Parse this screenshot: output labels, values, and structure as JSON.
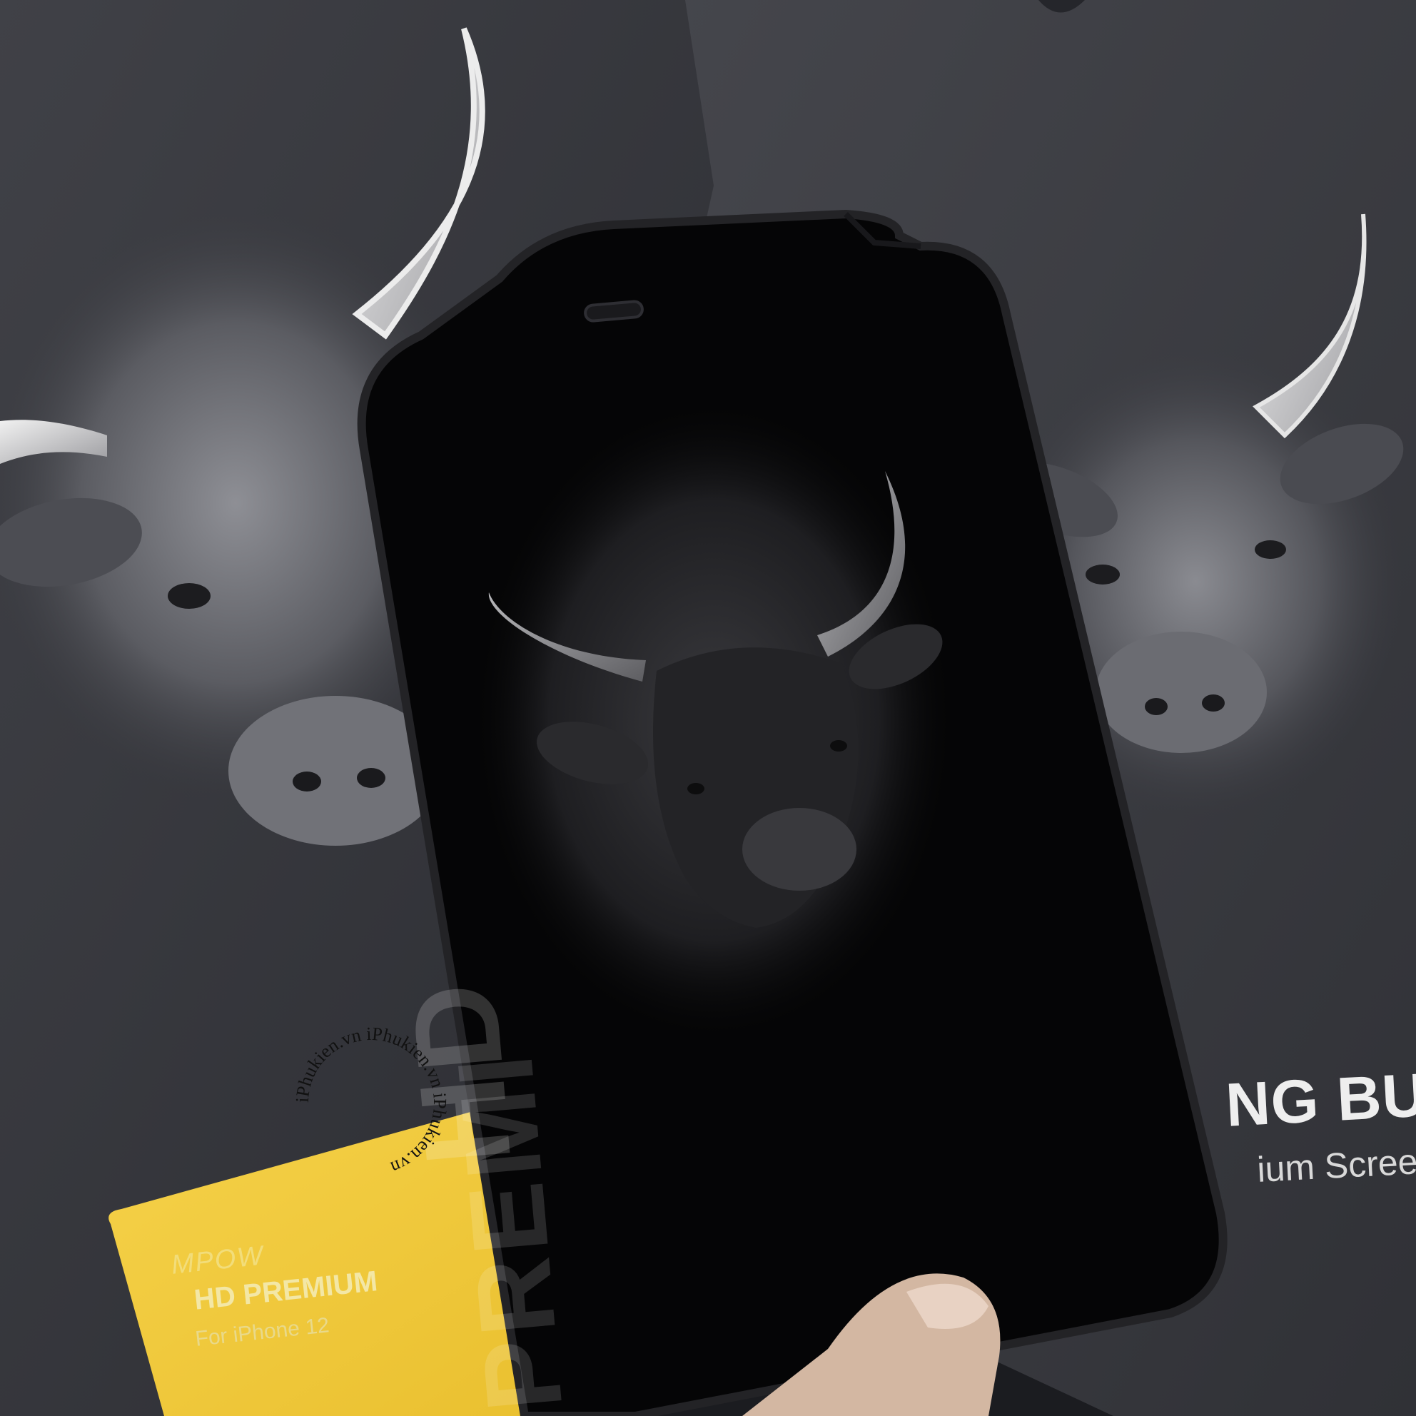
{
  "scene": {
    "left_box": {
      "brand": "MPOW",
      "title": "HD PREMIUM",
      "subtitle": "For iPhone 12",
      "large_text": "HD",
      "large_text_2": "PREMI"
    },
    "right_box": {
      "title": "NG BULL",
      "subtitle": "ium Screen Gu"
    },
    "watermark": {
      "text": "iPhukien.vn  iPhukien.vn  iPhukien.vn  "
    }
  }
}
